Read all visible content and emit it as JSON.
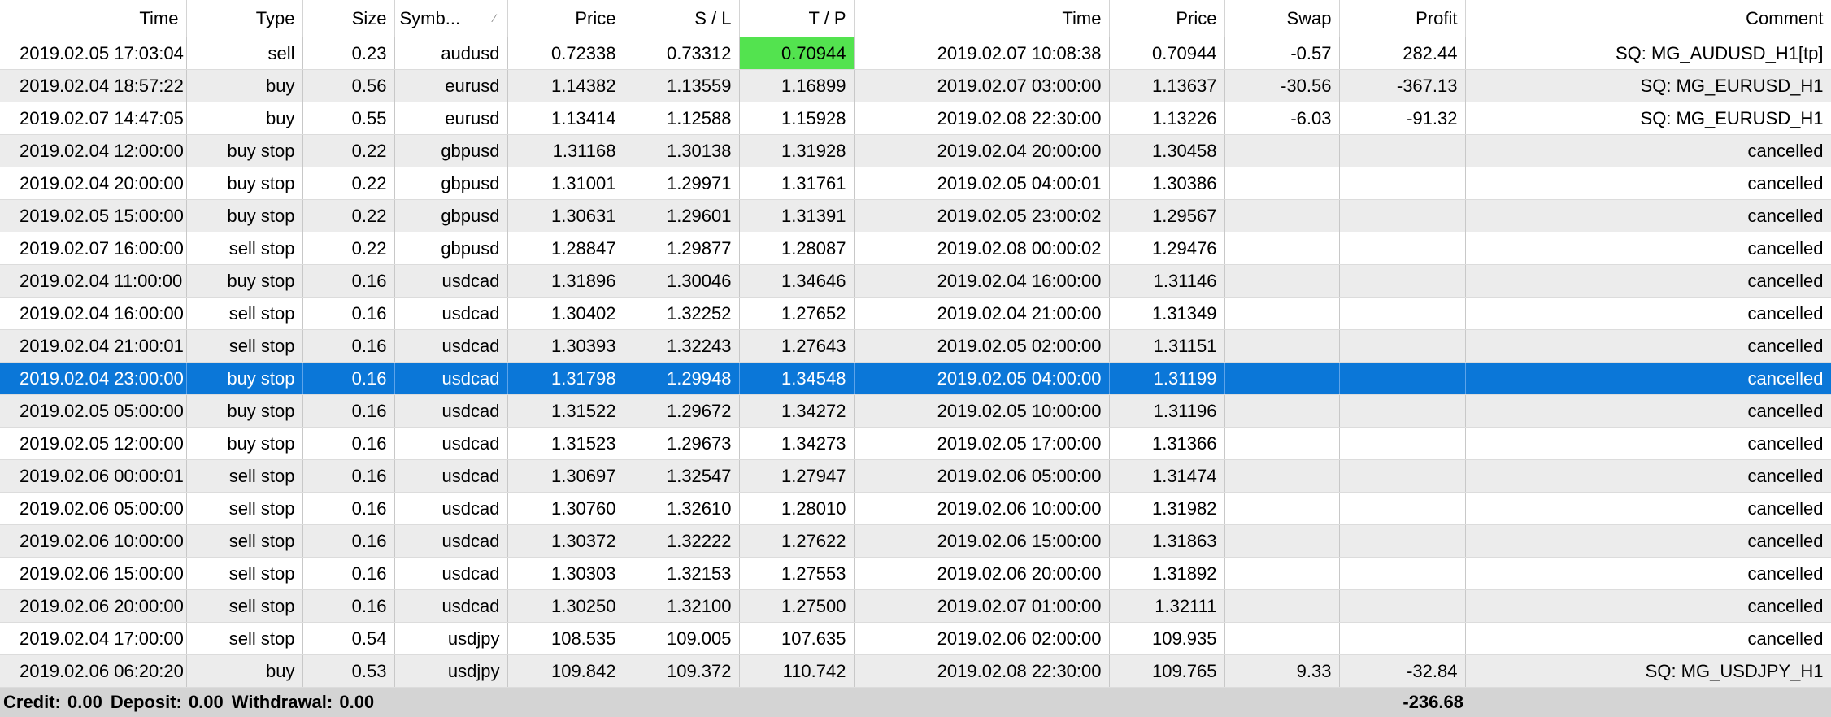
{
  "columns": {
    "time": "Time",
    "type": "Type",
    "size": "Size",
    "symbol": "Symb...",
    "price": "Price",
    "sl": "S / L",
    "tp": "T / P",
    "close_time": "Time",
    "close_price": "Price",
    "swap": "Swap",
    "profit": "Profit",
    "comment": "Comment"
  },
  "rows": [
    {
      "time": "2019.02.05 17:03:04",
      "type": "sell",
      "size": "0.23",
      "symbol": "audusd",
      "price": "0.72338",
      "sl": "0.73312",
      "tp": "0.70944",
      "close_time": "2019.02.07 10:08:38",
      "close_price": "0.70944",
      "swap": "-0.57",
      "profit": "282.44",
      "comment": "SQ: MG_AUDUSD_H1[tp]"
    },
    {
      "time": "2019.02.04 18:57:22",
      "type": "buy",
      "size": "0.56",
      "symbol": "eurusd",
      "price": "1.14382",
      "sl": "1.13559",
      "tp": "1.16899",
      "close_time": "2019.02.07 03:00:00",
      "close_price": "1.13637",
      "swap": "-30.56",
      "profit": "-367.13",
      "comment": "SQ: MG_EURUSD_H1"
    },
    {
      "time": "2019.02.07 14:47:05",
      "type": "buy",
      "size": "0.55",
      "symbol": "eurusd",
      "price": "1.13414",
      "sl": "1.12588",
      "tp": "1.15928",
      "close_time": "2019.02.08 22:30:00",
      "close_price": "1.13226",
      "swap": "-6.03",
      "profit": "-91.32",
      "comment": "SQ: MG_EURUSD_H1"
    },
    {
      "time": "2019.02.04 12:00:00",
      "type": "buy stop",
      "size": "0.22",
      "symbol": "gbpusd",
      "price": "1.31168",
      "sl": "1.30138",
      "tp": "1.31928",
      "close_time": "2019.02.04 20:00:00",
      "close_price": "1.30458",
      "swap": "",
      "profit": "",
      "comment": "cancelled"
    },
    {
      "time": "2019.02.04 20:00:00",
      "type": "buy stop",
      "size": "0.22",
      "symbol": "gbpusd",
      "price": "1.31001",
      "sl": "1.29971",
      "tp": "1.31761",
      "close_time": "2019.02.05 04:00:01",
      "close_price": "1.30386",
      "swap": "",
      "profit": "",
      "comment": "cancelled"
    },
    {
      "time": "2019.02.05 15:00:00",
      "type": "buy stop",
      "size": "0.22",
      "symbol": "gbpusd",
      "price": "1.30631",
      "sl": "1.29601",
      "tp": "1.31391",
      "close_time": "2019.02.05 23:00:02",
      "close_price": "1.29567",
      "swap": "",
      "profit": "",
      "comment": "cancelled"
    },
    {
      "time": "2019.02.07 16:00:00",
      "type": "sell stop",
      "size": "0.22",
      "symbol": "gbpusd",
      "price": "1.28847",
      "sl": "1.29877",
      "tp": "1.28087",
      "close_time": "2019.02.08 00:00:02",
      "close_price": "1.29476",
      "swap": "",
      "profit": "",
      "comment": "cancelled"
    },
    {
      "time": "2019.02.04 11:00:00",
      "type": "buy stop",
      "size": "0.16",
      "symbol": "usdcad",
      "price": "1.31896",
      "sl": "1.30046",
      "tp": "1.34646",
      "close_time": "2019.02.04 16:00:00",
      "close_price": "1.31146",
      "swap": "",
      "profit": "",
      "comment": "cancelled"
    },
    {
      "time": "2019.02.04 16:00:00",
      "type": "sell stop",
      "size": "0.16",
      "symbol": "usdcad",
      "price": "1.30402",
      "sl": "1.32252",
      "tp": "1.27652",
      "close_time": "2019.02.04 21:00:00",
      "close_price": "1.31349",
      "swap": "",
      "profit": "",
      "comment": "cancelled"
    },
    {
      "time": "2019.02.04 21:00:01",
      "type": "sell stop",
      "size": "0.16",
      "symbol": "usdcad",
      "price": "1.30393",
      "sl": "1.32243",
      "tp": "1.27643",
      "close_time": "2019.02.05 02:00:00",
      "close_price": "1.31151",
      "swap": "",
      "profit": "",
      "comment": "cancelled"
    },
    {
      "time": "2019.02.04 23:00:00",
      "type": "buy stop",
      "size": "0.16",
      "symbol": "usdcad",
      "price": "1.31798",
      "sl": "1.29948",
      "tp": "1.34548",
      "close_time": "2019.02.05 04:00:00",
      "close_price": "1.31199",
      "swap": "",
      "profit": "",
      "comment": "cancelled"
    },
    {
      "time": "2019.02.05 05:00:00",
      "type": "buy stop",
      "size": "0.16",
      "symbol": "usdcad",
      "price": "1.31522",
      "sl": "1.29672",
      "tp": "1.34272",
      "close_time": "2019.02.05 10:00:00",
      "close_price": "1.31196",
      "swap": "",
      "profit": "",
      "comment": "cancelled"
    },
    {
      "time": "2019.02.05 12:00:00",
      "type": "buy stop",
      "size": "0.16",
      "symbol": "usdcad",
      "price": "1.31523",
      "sl": "1.29673",
      "tp": "1.34273",
      "close_time": "2019.02.05 17:00:00",
      "close_price": "1.31366",
      "swap": "",
      "profit": "",
      "comment": "cancelled"
    },
    {
      "time": "2019.02.06 00:00:01",
      "type": "sell stop",
      "size": "0.16",
      "symbol": "usdcad",
      "price": "1.30697",
      "sl": "1.32547",
      "tp": "1.27947",
      "close_time": "2019.02.06 05:00:00",
      "close_price": "1.31474",
      "swap": "",
      "profit": "",
      "comment": "cancelled"
    },
    {
      "time": "2019.02.06 05:00:00",
      "type": "sell stop",
      "size": "0.16",
      "symbol": "usdcad",
      "price": "1.30760",
      "sl": "1.32610",
      "tp": "1.28010",
      "close_time": "2019.02.06 10:00:00",
      "close_price": "1.31982",
      "swap": "",
      "profit": "",
      "comment": "cancelled"
    },
    {
      "time": "2019.02.06 10:00:00",
      "type": "sell stop",
      "size": "0.16",
      "symbol": "usdcad",
      "price": "1.30372",
      "sl": "1.32222",
      "tp": "1.27622",
      "close_time": "2019.02.06 15:00:00",
      "close_price": "1.31863",
      "swap": "",
      "profit": "",
      "comment": "cancelled"
    },
    {
      "time": "2019.02.06 15:00:00",
      "type": "sell stop",
      "size": "0.16",
      "symbol": "usdcad",
      "price": "1.30303",
      "sl": "1.32153",
      "tp": "1.27553",
      "close_time": "2019.02.06 20:00:00",
      "close_price": "1.31892",
      "swap": "",
      "profit": "",
      "comment": "cancelled"
    },
    {
      "time": "2019.02.06 20:00:00",
      "type": "sell stop",
      "size": "0.16",
      "symbol": "usdcad",
      "price": "1.30250",
      "sl": "1.32100",
      "tp": "1.27500",
      "close_time": "2019.02.07 01:00:00",
      "close_price": "1.32111",
      "swap": "",
      "profit": "",
      "comment": "cancelled"
    },
    {
      "time": "2019.02.04 17:00:00",
      "type": "sell stop",
      "size": "0.54",
      "symbol": "usdjpy",
      "price": "108.535",
      "sl": "109.005",
      "tp": "107.635",
      "close_time": "2019.02.06 02:00:00",
      "close_price": "109.935",
      "swap": "",
      "profit": "",
      "comment": "cancelled"
    },
    {
      "time": "2019.02.06 06:20:20",
      "type": "buy",
      "size": "0.53",
      "symbol": "usdjpy",
      "price": "109.842",
      "sl": "109.372",
      "tp": "110.742",
      "close_time": "2019.02.08 22:30:00",
      "close_price": "109.765",
      "swap": "9.33",
      "profit": "-32.84",
      "comment": "SQ: MG_USDJPY_H1"
    }
  ],
  "selected_row_index": 10,
  "tp_hit_row_index": 0,
  "colors": {
    "selected_row": "#0b77d8",
    "tp_hit": "#53e34f",
    "alt_row": "#ececec",
    "footer": "#d4d4d4"
  },
  "footer": {
    "credit": "Credit: 0.00",
    "deposit": "Deposit: 0.00",
    "withdrawal": "Withdrawal: 0.00",
    "total_profit": "-236.68"
  },
  "icons": {
    "sort": "sort-indicator-icon"
  }
}
